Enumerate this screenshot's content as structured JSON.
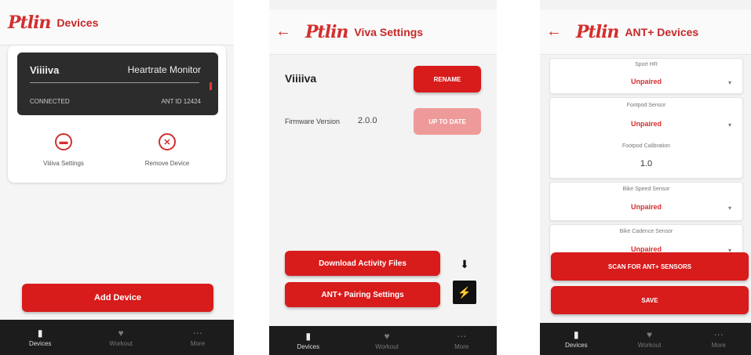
{
  "brand": {
    "logo_text": "Ptlin",
    "accent": "#d81b1b",
    "dark": "#1c1c1c"
  },
  "nav": [
    {
      "label": "Devices",
      "icon": "device-icon"
    },
    {
      "label": "Workout",
      "icon": "workout-icon"
    },
    {
      "label": "More",
      "icon": "more-icon"
    }
  ],
  "screen1": {
    "title": "Devices",
    "device": {
      "name": "Viiiiva",
      "type": "Heartrate Monitor",
      "status": "CONNECTED",
      "ant_id": "ANT ID 12424"
    },
    "actions": [
      {
        "label": "Viiiiva Settings",
        "icon": "settings-icon"
      },
      {
        "label": "Remove Device",
        "icon": "remove-icon"
      }
    ],
    "add_button": "Add Device"
  },
  "screen2": {
    "title": "Viva Settings",
    "device_name": "Viiiiva",
    "rename_button": "RENAME",
    "firmware_label": "Firmware Version",
    "firmware_value": "2.0.0",
    "update_button": "UP TO DATE",
    "download_button": "Download Activity Files",
    "ant_button": "ANT+ Pairing Settings"
  },
  "screen3": {
    "title": "ANT+ Devices",
    "sensors": [
      {
        "label": "Sport HR",
        "value": "Unpaired"
      },
      {
        "label": "Footpod Sensor",
        "value": "Unpaired",
        "calibration_label": "Footpod Calibration",
        "calibration_value": "1.0"
      },
      {
        "label": "Bike Speed Sensor",
        "value": "Unpaired"
      },
      {
        "label": "Bike Cadence Sensor",
        "value": "Unpaired"
      }
    ],
    "scan_button": "SCAN FOR ANT+ SENSORS",
    "save_button": "SAVE"
  }
}
